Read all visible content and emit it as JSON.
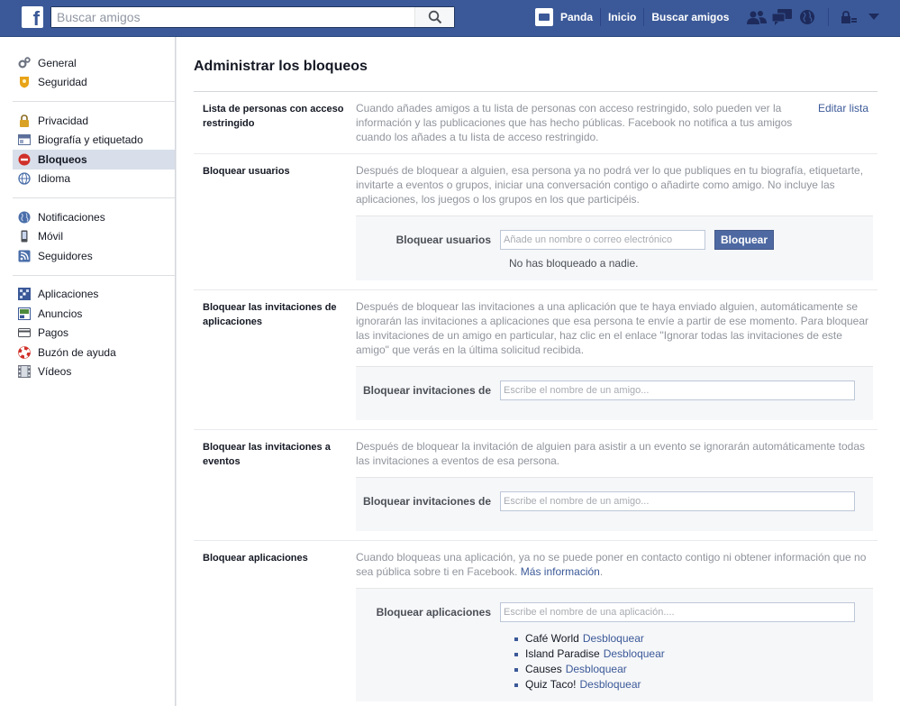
{
  "topbar": {
    "logo": "f",
    "search_placeholder": "Buscar amigos",
    "user_name": "Panda",
    "nav": [
      "Inicio",
      "Buscar amigos"
    ],
    "icons": [
      "friend-requests-icon",
      "messages-icon",
      "notifications-globe-icon",
      "privacy-lock-icon",
      "account-menu-chevron-icon"
    ]
  },
  "sidebar": {
    "groups": [
      [
        {
          "label": "General",
          "icon": "gear-icon",
          "color": "#6d7380"
        },
        {
          "label": "Seguridad",
          "icon": "badge-icon",
          "color": "#e8a316"
        }
      ],
      [
        {
          "label": "Privacidad",
          "icon": "lock-icon",
          "color": "#d9a225"
        },
        {
          "label": "Biografía y etiquetado",
          "icon": "timeline-icon",
          "color": "#5b6f9a"
        },
        {
          "label": "Bloqueos",
          "icon": "block-icon",
          "color": "#d0302a",
          "selected": true
        },
        {
          "label": "Idioma",
          "icon": "globe-icon",
          "color": "#4a6ea9"
        }
      ],
      [
        {
          "label": "Notificaciones",
          "icon": "globe-notification-icon",
          "color": "#4a6ea9"
        },
        {
          "label": "Móvil",
          "icon": "mobile-icon",
          "color": "#4b4f56"
        },
        {
          "label": "Seguidores",
          "icon": "rss-icon",
          "color": "#4a6ea9"
        }
      ],
      [
        {
          "label": "Aplicaciones",
          "icon": "apps-icon",
          "color": "#3b5998"
        },
        {
          "label": "Anuncios",
          "icon": "ads-icon",
          "color": "#4e8a3c"
        },
        {
          "label": "Pagos",
          "icon": "card-icon",
          "color": "#6d7380"
        },
        {
          "label": "Buzón de ayuda",
          "icon": "lifebuoy-icon",
          "color": "#d0302a"
        },
        {
          "label": "Vídeos",
          "icon": "film-icon",
          "color": "#6d7380"
        }
      ]
    ]
  },
  "main": {
    "title": "Administrar los bloqueos",
    "restricted": {
      "label": "Lista de personas con acceso restringido",
      "desc": "Cuando añades amigos a tu lista de personas con acceso restringido, solo pueden ver la información y las publicaciones que has hecho públicas. Facebook no notifica a tus amigos cuando los añades a tu lista de acceso restringido.",
      "edit": "Editar lista"
    },
    "block_users": {
      "label": "Bloquear usuarios",
      "desc": "Después de bloquear a alguien, esa persona ya no podrá ver lo que publiques en tu biografía, etiquetarte, invitarte a eventos o grupos, iniciar una conversación contigo o añadirte como amigo. No incluye las aplicaciones, los juegos o los grupos en los que participéis.",
      "field_label": "Bloquear usuarios",
      "placeholder": "Añade un nombre o correo electrónico",
      "button": "Bloquear",
      "note": "No has bloqueado a nadie."
    },
    "block_app_invites": {
      "label": "Bloquear las invitaciones de aplicaciones",
      "desc": "Después de bloquear las invitaciones a una aplicación que te haya enviado alguien, automáticamente se ignorarán las invitaciones a aplicaciones que esa persona te envíe a partir de ese momento. Para bloquear las invitaciones de un amigo en particular, haz clic en el enlace \"Ignorar todas las invitaciones de este amigo\" que verás en la última solicitud recibida.",
      "field_label": "Bloquear invitaciones de",
      "placeholder": "Escribe el nombre de un amigo..."
    },
    "block_event_invites": {
      "label": "Bloquear las invitaciones a eventos",
      "desc": "Después de bloquear la invitación de alguien para asistir a un evento se ignorarán automáticamente todas las invitaciones a eventos de esa persona.",
      "field_label": "Bloquear invitaciones de",
      "placeholder": "Escribe el nombre de un amigo..."
    },
    "block_apps": {
      "label": "Bloquear aplicaciones",
      "desc": "Cuando bloqueas una aplicación, ya no se puede poner en contacto contigo ni obtener información que no sea pública sobre ti en Facebook.",
      "more_link": "Más información",
      "desc_end": ".",
      "field_label": "Bloquear aplicaciones",
      "placeholder": "Escribe el nombre de una aplicación....",
      "unblock_label": "Desbloquear",
      "apps": [
        "Café World",
        "Island Paradise",
        "Causes",
        "Quiz Taco!"
      ]
    }
  }
}
